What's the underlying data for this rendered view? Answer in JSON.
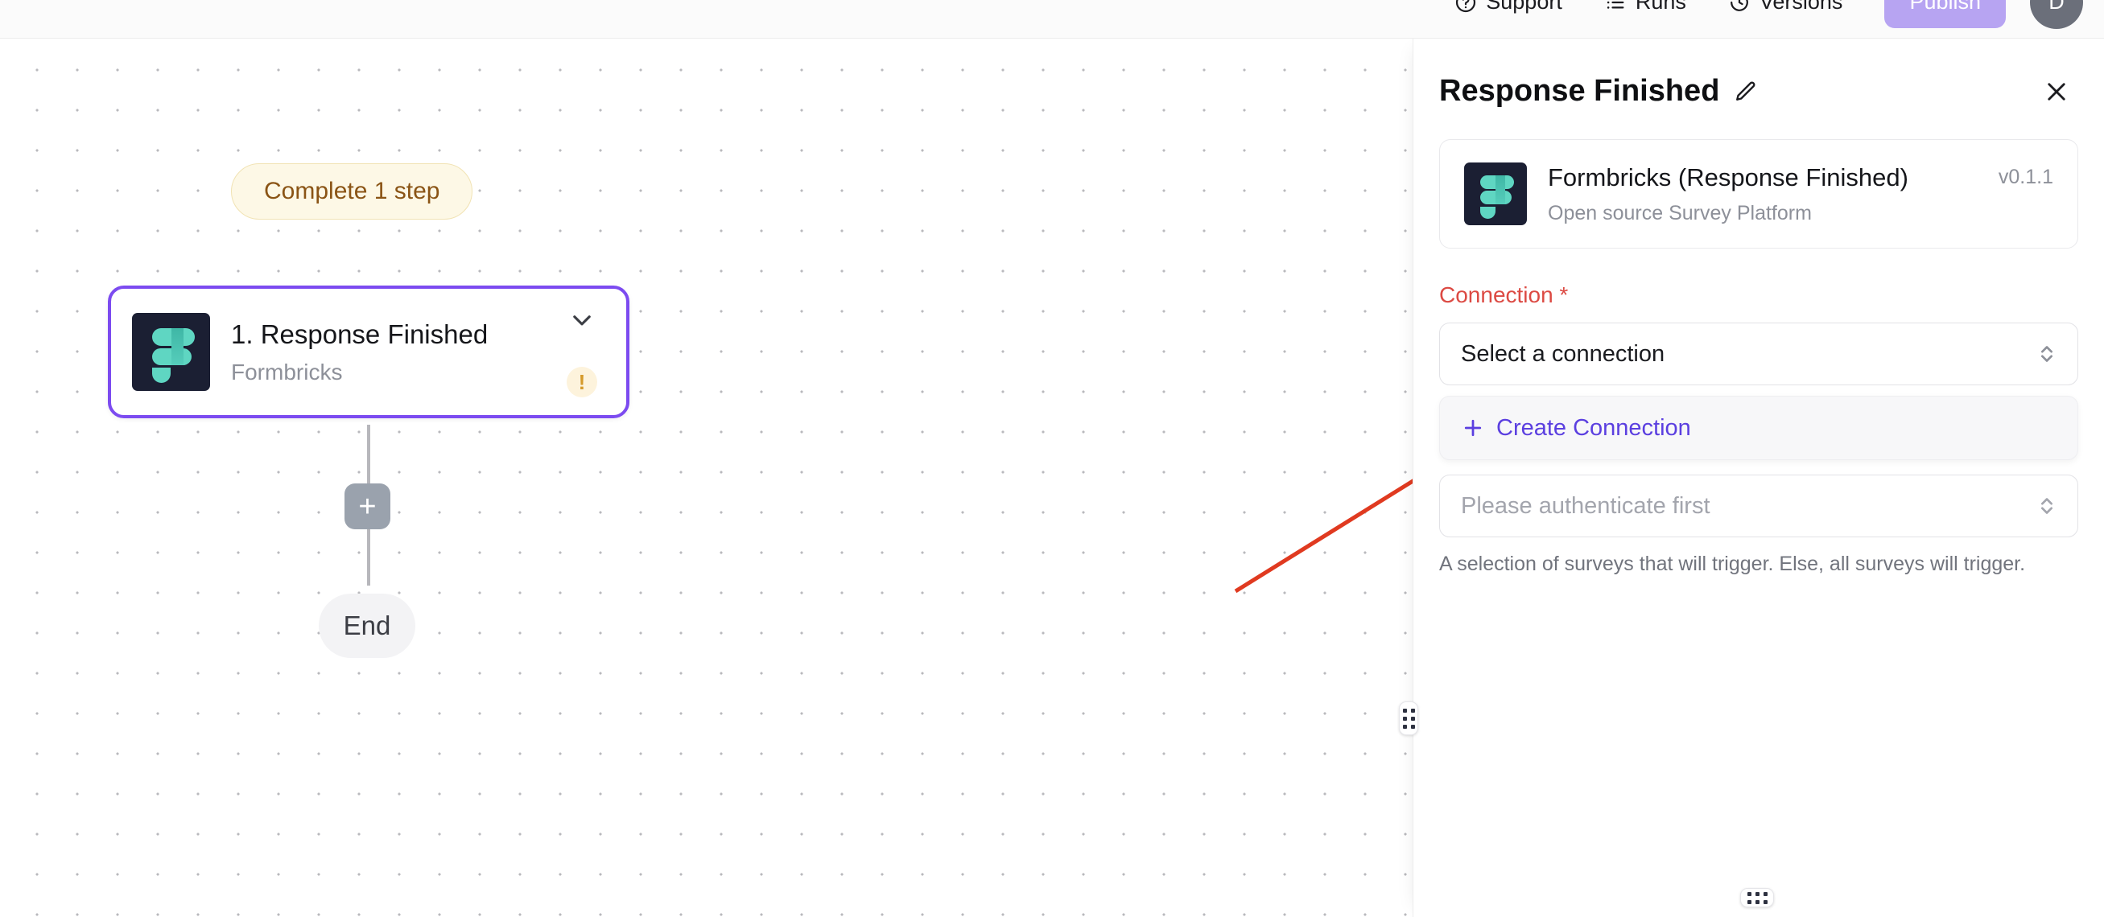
{
  "topbar": {
    "nav": [
      {
        "label": "Support",
        "icon": "help-circle-icon"
      },
      {
        "label": "Runs",
        "icon": "list-icon"
      },
      {
        "label": "Versions",
        "icon": "history-clock-icon"
      }
    ],
    "publish_label": "Publish",
    "avatar_initial": "D",
    "publish_color": "#b7a4f2"
  },
  "canvas": {
    "complete_badge": "Complete 1 step",
    "badge_bg": "#fdf8e6",
    "badge_text_color": "#8a5415",
    "node": {
      "title": "1. Response Finished",
      "subtitle": "Formbricks",
      "icon": "formbricks-logo-icon",
      "chevron": "chevron-down-icon",
      "warning": "!",
      "selected_border_color": "#7c4bf0"
    },
    "add_step_label": "+",
    "end_label": "End",
    "annotation": {
      "type": "arrow",
      "color": "#e03a20",
      "points": "from (1535,735) to (1813,562)"
    }
  },
  "panel": {
    "title": "Response Finished",
    "edit_icon": "pencil-icon",
    "close_icon": "close-icon",
    "integration": {
      "name": "Formbricks (Response Finished)",
      "description": "Open source Survey Platform",
      "version": "v0.1.1",
      "icon": "formbricks-logo-icon"
    },
    "connection": {
      "label": "Connection *",
      "label_color": "#dc4a43",
      "select_value": "Select a connection",
      "create_label": "Create Connection",
      "create_icon": "plus-icon",
      "create_color": "#5b3fe0"
    },
    "surveys": {
      "placeholder": "Please authenticate first",
      "help_text": "A selection of surveys that will trigger. Else, all surveys will trigger."
    }
  }
}
